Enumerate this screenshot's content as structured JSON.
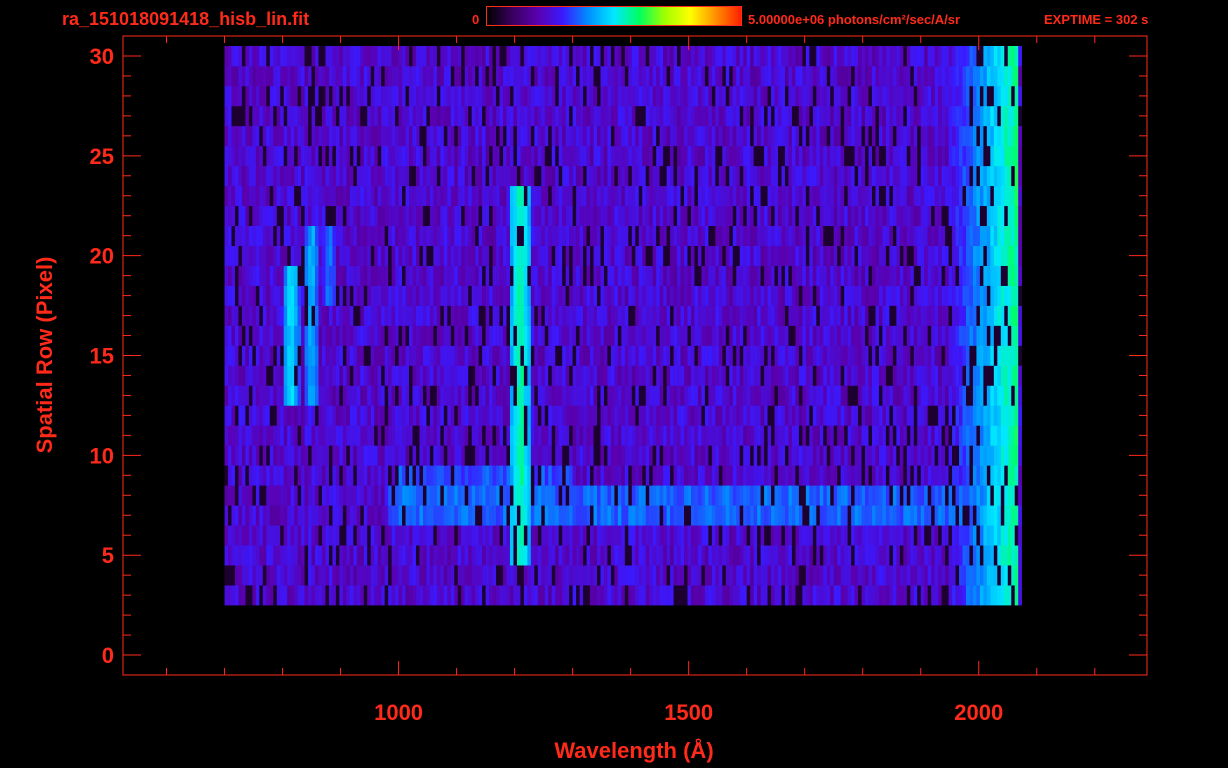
{
  "header": {
    "filename": "ra_151018091418_hisb_lin.fit",
    "colorbar_min_label": "0",
    "colorbar_max_label": "5.00000e+06 photons/cm²/sec/A/sr",
    "exptime_label": "EXPTIME = 302 s"
  },
  "colors": {
    "axis": "#ff2a1a",
    "background": "#000000",
    "colormap": [
      "#000000",
      "#3a0060",
      "#5a00b0",
      "#3a1aff",
      "#0090ff",
      "#00e8ff",
      "#00ff60",
      "#a0ff00",
      "#ffff00",
      "#ff9000",
      "#ff2000"
    ]
  },
  "chart_data": {
    "type": "heatmap",
    "title": "ra_151018091418_hisb_lin.fit",
    "xlabel": "Wavelength (Å)",
    "ylabel": "Spatial Row (Pixel)",
    "xlim": [
      525,
      2290
    ],
    "ylim": [
      -1,
      31
    ],
    "x_ticks": [
      1000,
      1500,
      2000
    ],
    "y_ticks": [
      0,
      5,
      10,
      15,
      20,
      25,
      30
    ],
    "zlim": [
      0,
      5000000
    ],
    "zunit": "photons/cm²/sec/A/sr",
    "data_extent": {
      "x": [
        700,
        2070
      ],
      "rows": [
        3,
        30
      ]
    },
    "features": [
      {
        "name": "emission band",
        "x_center": 1210,
        "x_width": 40,
        "rows": [
          5,
          23
        ],
        "peak_level": 0.55
      },
      {
        "name": "emission band",
        "x_center": 815,
        "x_width": 30,
        "rows": [
          13,
          19
        ],
        "peak_level": 0.48
      },
      {
        "name": "emission band",
        "x_center": 850,
        "x_width": 30,
        "rows": [
          13,
          21
        ],
        "peak_level": 0.42
      },
      {
        "name": "emission band",
        "x_center": 880,
        "x_width": 30,
        "rows": [
          18,
          22
        ],
        "peak_level": 0.36
      },
      {
        "name": "continuum",
        "x_range": [
          980,
          2020
        ],
        "rows": [
          7,
          8
        ],
        "peak_level": 0.32
      },
      {
        "name": "continuum",
        "x_range": [
          1000,
          1300
        ],
        "rows": [
          8,
          9
        ],
        "peak_level": 0.3
      },
      {
        "name": "edge rise",
        "x_range": [
          1950,
          2070
        ],
        "rows": [
          0,
          30
        ],
        "peak_level": 0.55
      }
    ]
  }
}
